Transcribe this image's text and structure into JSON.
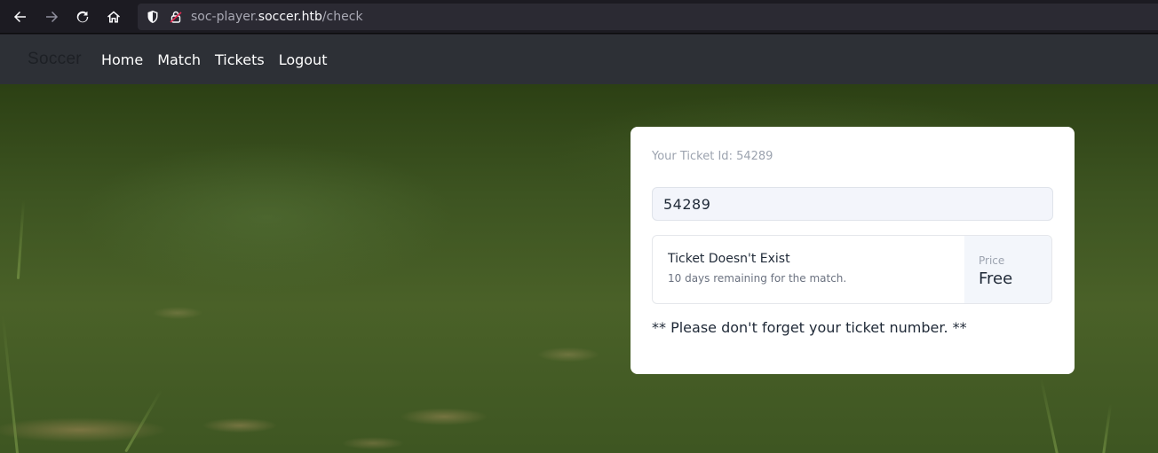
{
  "browser": {
    "url_prefix": "soc-player.",
    "url_domain": "soccer.htb",
    "url_path": "/check",
    "icons": [
      "back-arrow-icon",
      "forward-arrow-icon",
      "reload-icon",
      "home-icon",
      "shield-icon",
      "lock-icon"
    ]
  },
  "navbar": {
    "brand": "Soccer",
    "links": [
      "Home",
      "Match",
      "Tickets",
      "Logout"
    ]
  },
  "card": {
    "ticket_id_label": "Your Ticket Id: 54289",
    "input_value": "54289",
    "result_title": "Ticket Doesn't Exist",
    "result_subtitle": "10 days remaining for the match.",
    "price_label": "Price",
    "price_value": "Free",
    "reminder": "** Please don't forget your ticket number. **"
  }
}
